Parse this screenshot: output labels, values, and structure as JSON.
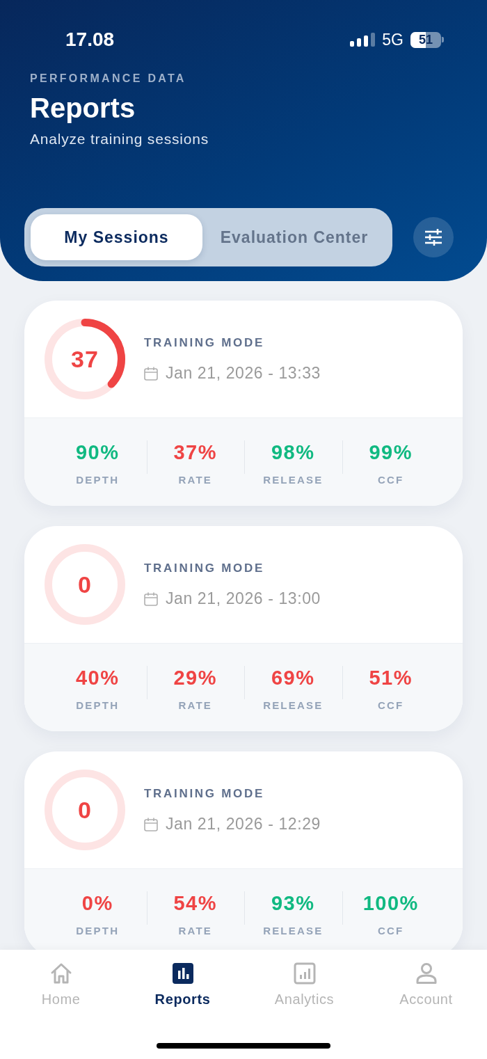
{
  "status_bar": {
    "time": "17.08",
    "network": "5G",
    "battery": {
      "reading": "51",
      "level": 0.51
    }
  },
  "header": {
    "eyebrow": "PERFORMANCE DATA",
    "title": "Reports",
    "subtitle": "Analyze training sessions"
  },
  "tabs": [
    {
      "label": "My Sessions",
      "selected": true
    },
    {
      "label": "Evaluation Center",
      "selected": false
    }
  ],
  "sessions": [
    {
      "score": "37",
      "level": 0.37,
      "mode": "TRAINING MODE",
      "date": "Jan 21, 2026 - 13:33",
      "metrics": [
        {
          "value": "90%",
          "label": "DEPTH",
          "color": "#10b981"
        },
        {
          "value": "37%",
          "label": "RATE",
          "color": "#ef4444"
        },
        {
          "value": "98%",
          "label": "RELEASE",
          "color": "#10b981"
        },
        {
          "value": "99%",
          "label": "CCF",
          "color": "#10b981"
        }
      ]
    },
    {
      "score": "0",
      "level": 0,
      "mode": "TRAINING MODE",
      "date": "Jan 21, 2026 - 13:00",
      "metrics": [
        {
          "value": "40%",
          "label": "DEPTH",
          "color": "#ef4444"
        },
        {
          "value": "29%",
          "label": "RATE",
          "color": "#ef4444"
        },
        {
          "value": "69%",
          "label": "RELEASE",
          "color": "#ef4444"
        },
        {
          "value": "51%",
          "label": "CCF",
          "color": "#ef4444"
        }
      ]
    },
    {
      "score": "0",
      "level": 0,
      "mode": "TRAINING MODE",
      "date": "Jan 21, 2026 - 12:29",
      "metrics": [
        {
          "value": "0%",
          "label": "DEPTH",
          "color": "#ef4444"
        },
        {
          "value": "54%",
          "label": "RATE",
          "color": "#ef4444"
        },
        {
          "value": "93%",
          "label": "RELEASE",
          "color": "#10b981"
        },
        {
          "value": "100%",
          "label": "CCF",
          "color": "#10b981"
        }
      ]
    }
  ],
  "tab_bar": [
    {
      "label": "Home",
      "selected": false
    },
    {
      "label": "Reports",
      "selected": true
    },
    {
      "label": "Analytics",
      "selected": false
    },
    {
      "label": "Account",
      "selected": false
    }
  ]
}
